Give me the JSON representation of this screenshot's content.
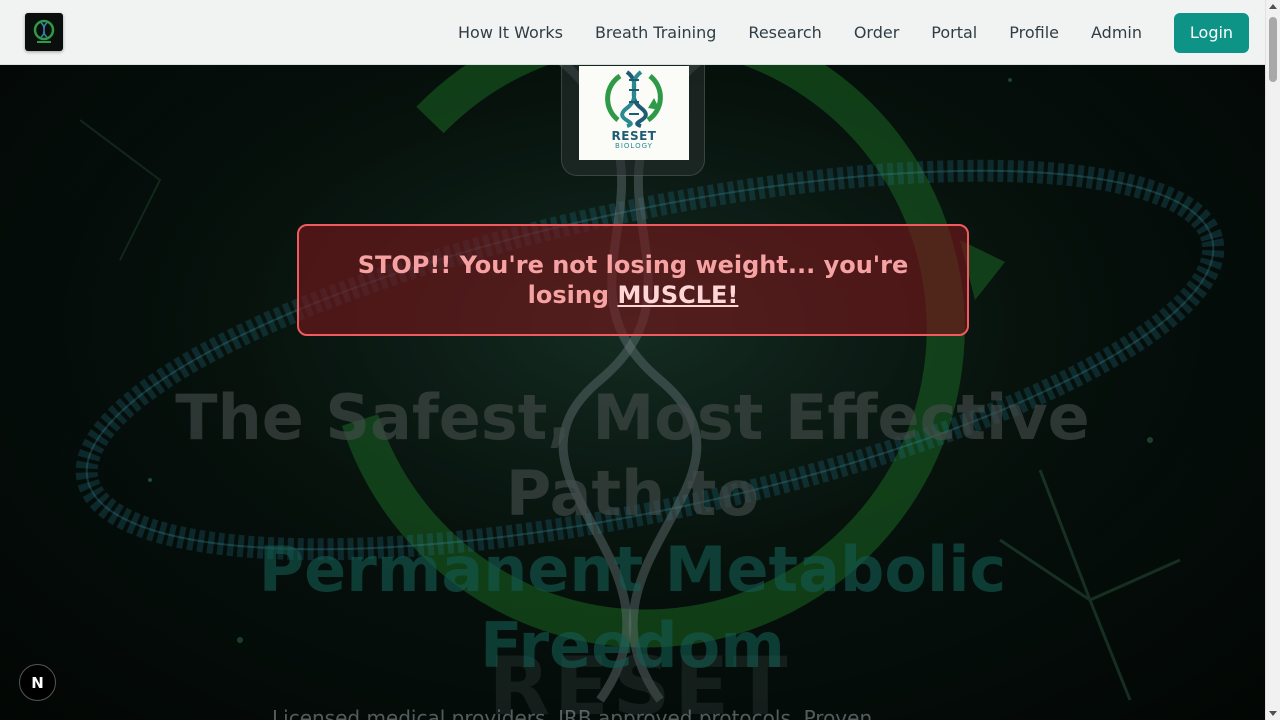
{
  "navbar": {
    "logo_icon": "reset-biology-dna-logo",
    "links": [
      {
        "label": "How It Works"
      },
      {
        "label": "Breath Training"
      },
      {
        "label": "Research"
      },
      {
        "label": "Order"
      },
      {
        "label": "Portal"
      },
      {
        "label": "Profile"
      },
      {
        "label": "Admin"
      }
    ],
    "login_label": "Login"
  },
  "hero": {
    "logo": {
      "icon": "dna-recycle-icon",
      "word": "RESET",
      "sub": "BIOLOGY"
    },
    "banner": {
      "text_before": "STOP!! You're not losing weight... you're losing ",
      "emphasis": "MUSCLE!"
    },
    "headline_line1": "The Safest, Most Effective Path to",
    "headline_line2": "Permanent Metabolic Freedom",
    "ghost_word": "RESET",
    "subtext": "Licensed medical providers. IRB approved protocols. Proven"
  },
  "dev_badge": {
    "label": "N"
  },
  "colors": {
    "accent": "#0e9486",
    "banner_border": "#ef5b5f",
    "banner_text": "#f6a2a2"
  }
}
